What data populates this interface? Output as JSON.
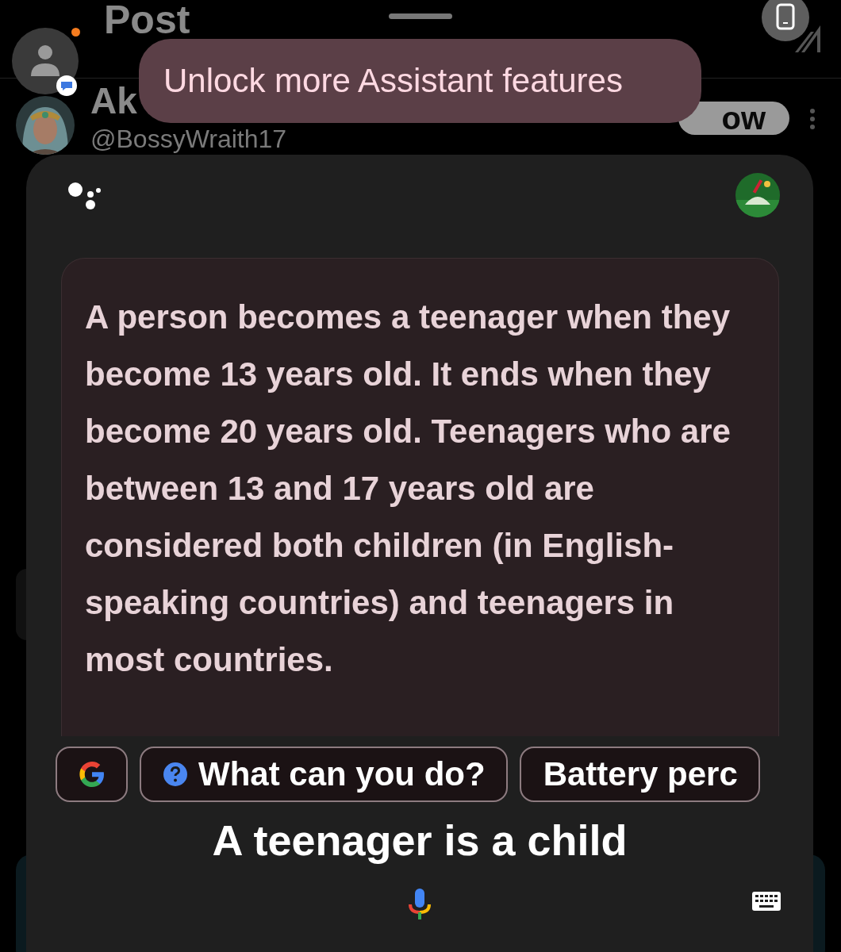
{
  "background_app": {
    "header": {
      "title": "Post"
    },
    "post": {
      "author_name": "Ak",
      "handle": "@BossyWraith17",
      "follow_button": "ow"
    }
  },
  "toast": {
    "text": "Unlock more Assistant features"
  },
  "assistant": {
    "answer": "A person becomes a teenager when they become 13 years old. It ends when they become 20 years old. Teenagers who are between 13 and 17 years old are considered both children (in English-speaking countries) and teenagers in most countries.",
    "chips": [
      {
        "kind": "google"
      },
      {
        "kind": "help",
        "label": "What can you do?"
      },
      {
        "kind": "plain",
        "label": "Battery perc"
      }
    ],
    "query": "A teenager is a child"
  }
}
